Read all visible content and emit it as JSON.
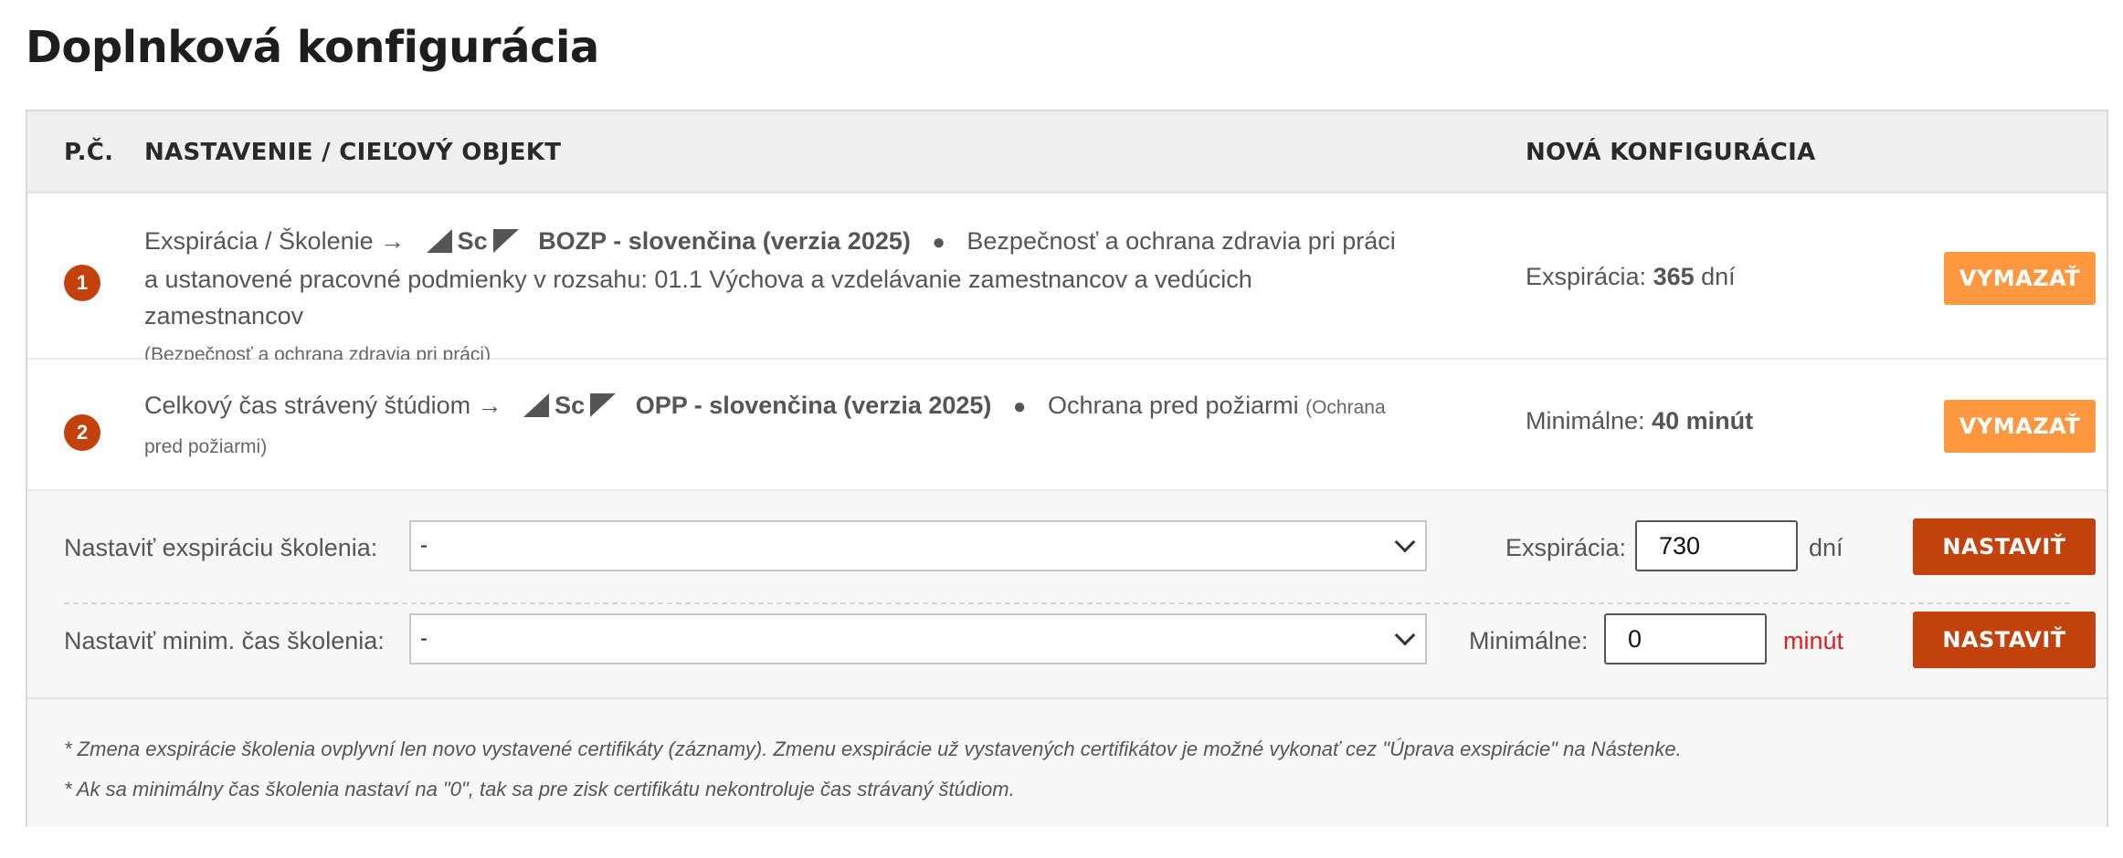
{
  "page_title": "Doplnková konfigurácia",
  "table": {
    "headers": {
      "number": "P.Č.",
      "setting": "NASTAVENIE / CIEĽOVÝ OBJEKT",
      "config": "NOVÁ KONFIGURÁCIA"
    },
    "rows": [
      {
        "number": "1",
        "prefix": "Exspirácia / Školenie →",
        "logo_text": "Sc",
        "course": "BOZP - slovenčina (verzia 2025)",
        "bullet": "●",
        "description": "Bezpečnosť a ochrana zdravia pri práci a ustanovené pracovné podmienky v rozsahu: 01.1 Výchova a vzdelávanie zamestnancov a vedúcich zamestnancov",
        "category": "(Bezpečnosť a ochrana zdravia pri práci)",
        "config_label": "Exspirácia:",
        "config_value": "365",
        "config_unit": "dní",
        "delete_label": "VYMAZAŤ"
      },
      {
        "number": "2",
        "prefix": "Celkový čas strávený štúdiom →",
        "logo_text": "Sc",
        "course": "OPP - slovenčina (verzia 2025)",
        "bullet": "●",
        "description": "Ochrana pred požiarmi",
        "category": "(Ochrana pred požiarmi)",
        "config_label": "Minimálne:",
        "config_value": "40 minút",
        "delete_label": "VYMAZAŤ"
      }
    ]
  },
  "settings": {
    "expiration": {
      "label": "Nastaviť exspiráciu školenia:",
      "select_value": "-",
      "input_label": "Exspirácia:",
      "input_value": "730",
      "unit": "dní",
      "button": "NASTAVIŤ"
    },
    "min_time": {
      "label": "Nastaviť minim. čas školenia:",
      "select_value": "-",
      "input_label": "Minimálne:",
      "input_value": "0",
      "unit": "minút",
      "button": "NASTAVIŤ"
    }
  },
  "notes": [
    "* Zmena exspirácie školenia ovplyvní len novo vystavené certifikáty (záznamy). Zmenu exspirácie už vystavených certifikátov je možné vykonať cez \"Úprava exspirácie\" na Nástenke.",
    "* Ak sa minimálny čas školenia nastaví na \"0\", tak sa pre zisk certifikátu nekontroluje čas strávaný štúdiom."
  ],
  "colors": {
    "badge": "#c2410c",
    "delete_button": "#fd9840",
    "set_button": "#c2410c",
    "warning_unit": "#e31d1d"
  }
}
